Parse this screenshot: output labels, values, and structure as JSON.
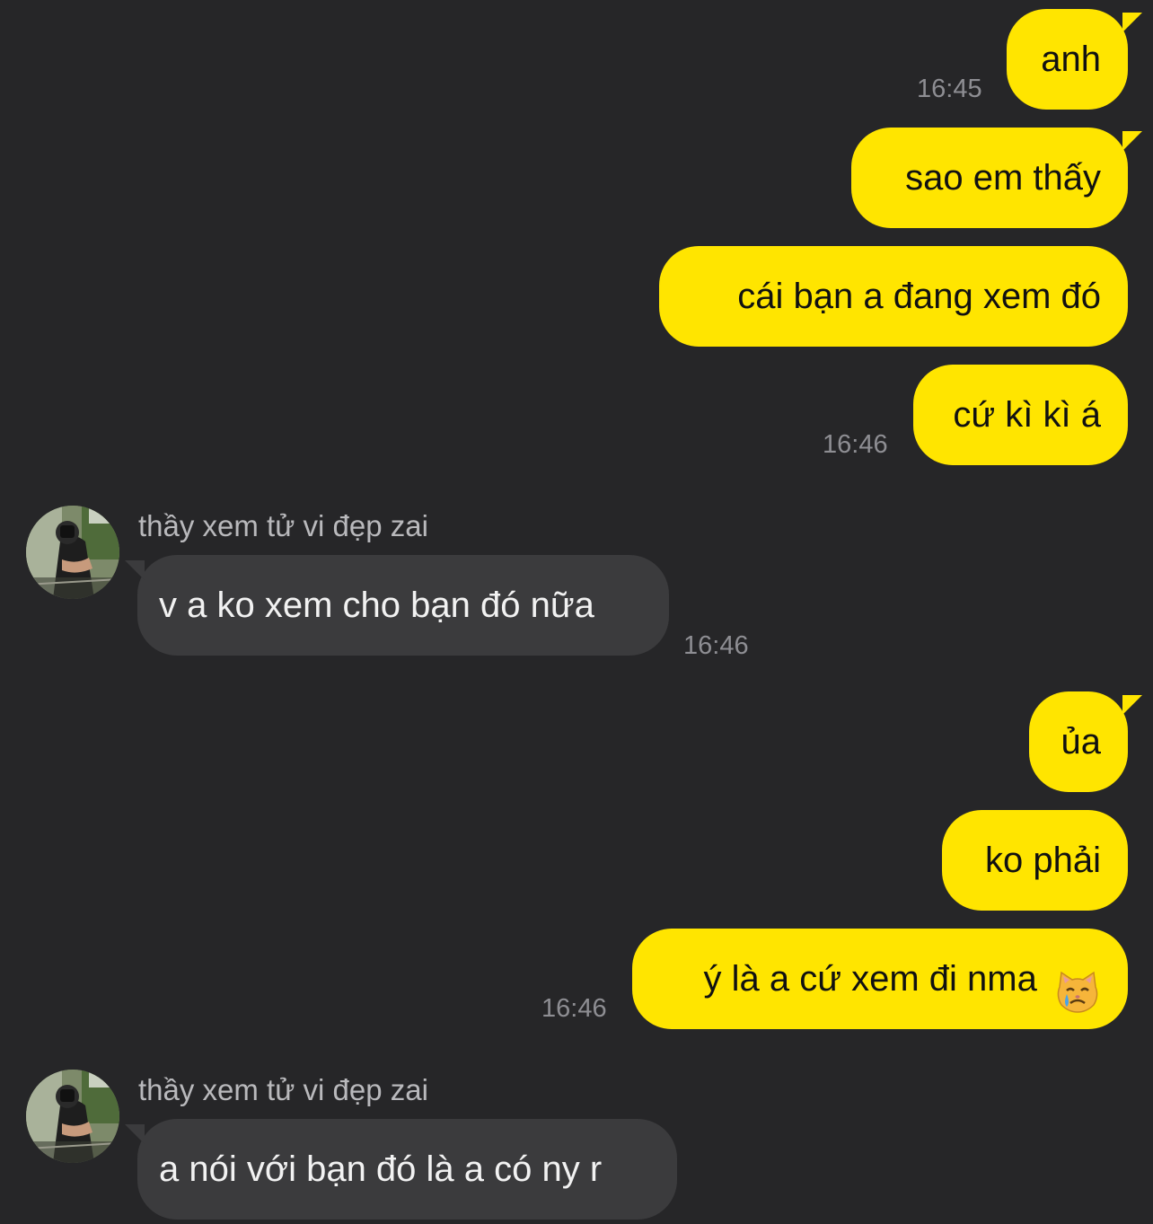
{
  "contact": {
    "name": "thầy xem tử vi đẹp zai",
    "avatar_icon": "user-photo-avatar"
  },
  "colors": {
    "background": "#262628",
    "outgoing_bubble": "#FFE500",
    "incoming_bubble": "#3B3B3D",
    "timestamp": "#8E8E93"
  },
  "messages": [
    {
      "direction": "outgoing",
      "text": "anh",
      "time": "16:45"
    },
    {
      "direction": "outgoing",
      "text": "sao em thấy"
    },
    {
      "direction": "outgoing",
      "text": "cái bạn a đang xem đó"
    },
    {
      "direction": "outgoing",
      "text": "cứ kì kì á",
      "time": "16:46"
    },
    {
      "direction": "incoming",
      "sender": "thầy xem tử vi đẹp zai",
      "text": "v a ko xem cho bạn đó nữa",
      "time": "16:46"
    },
    {
      "direction": "outgoing",
      "text": "ủa"
    },
    {
      "direction": "outgoing",
      "text": "ko phải"
    },
    {
      "direction": "outgoing",
      "text": "ý là a cứ xem đi nma",
      "emoji": "crying-cat-face-icon",
      "time": "16:46"
    },
    {
      "direction": "incoming",
      "sender": "thầy xem tử vi đẹp zai",
      "text": "a nói với bạn đó là a có ny r"
    }
  ]
}
